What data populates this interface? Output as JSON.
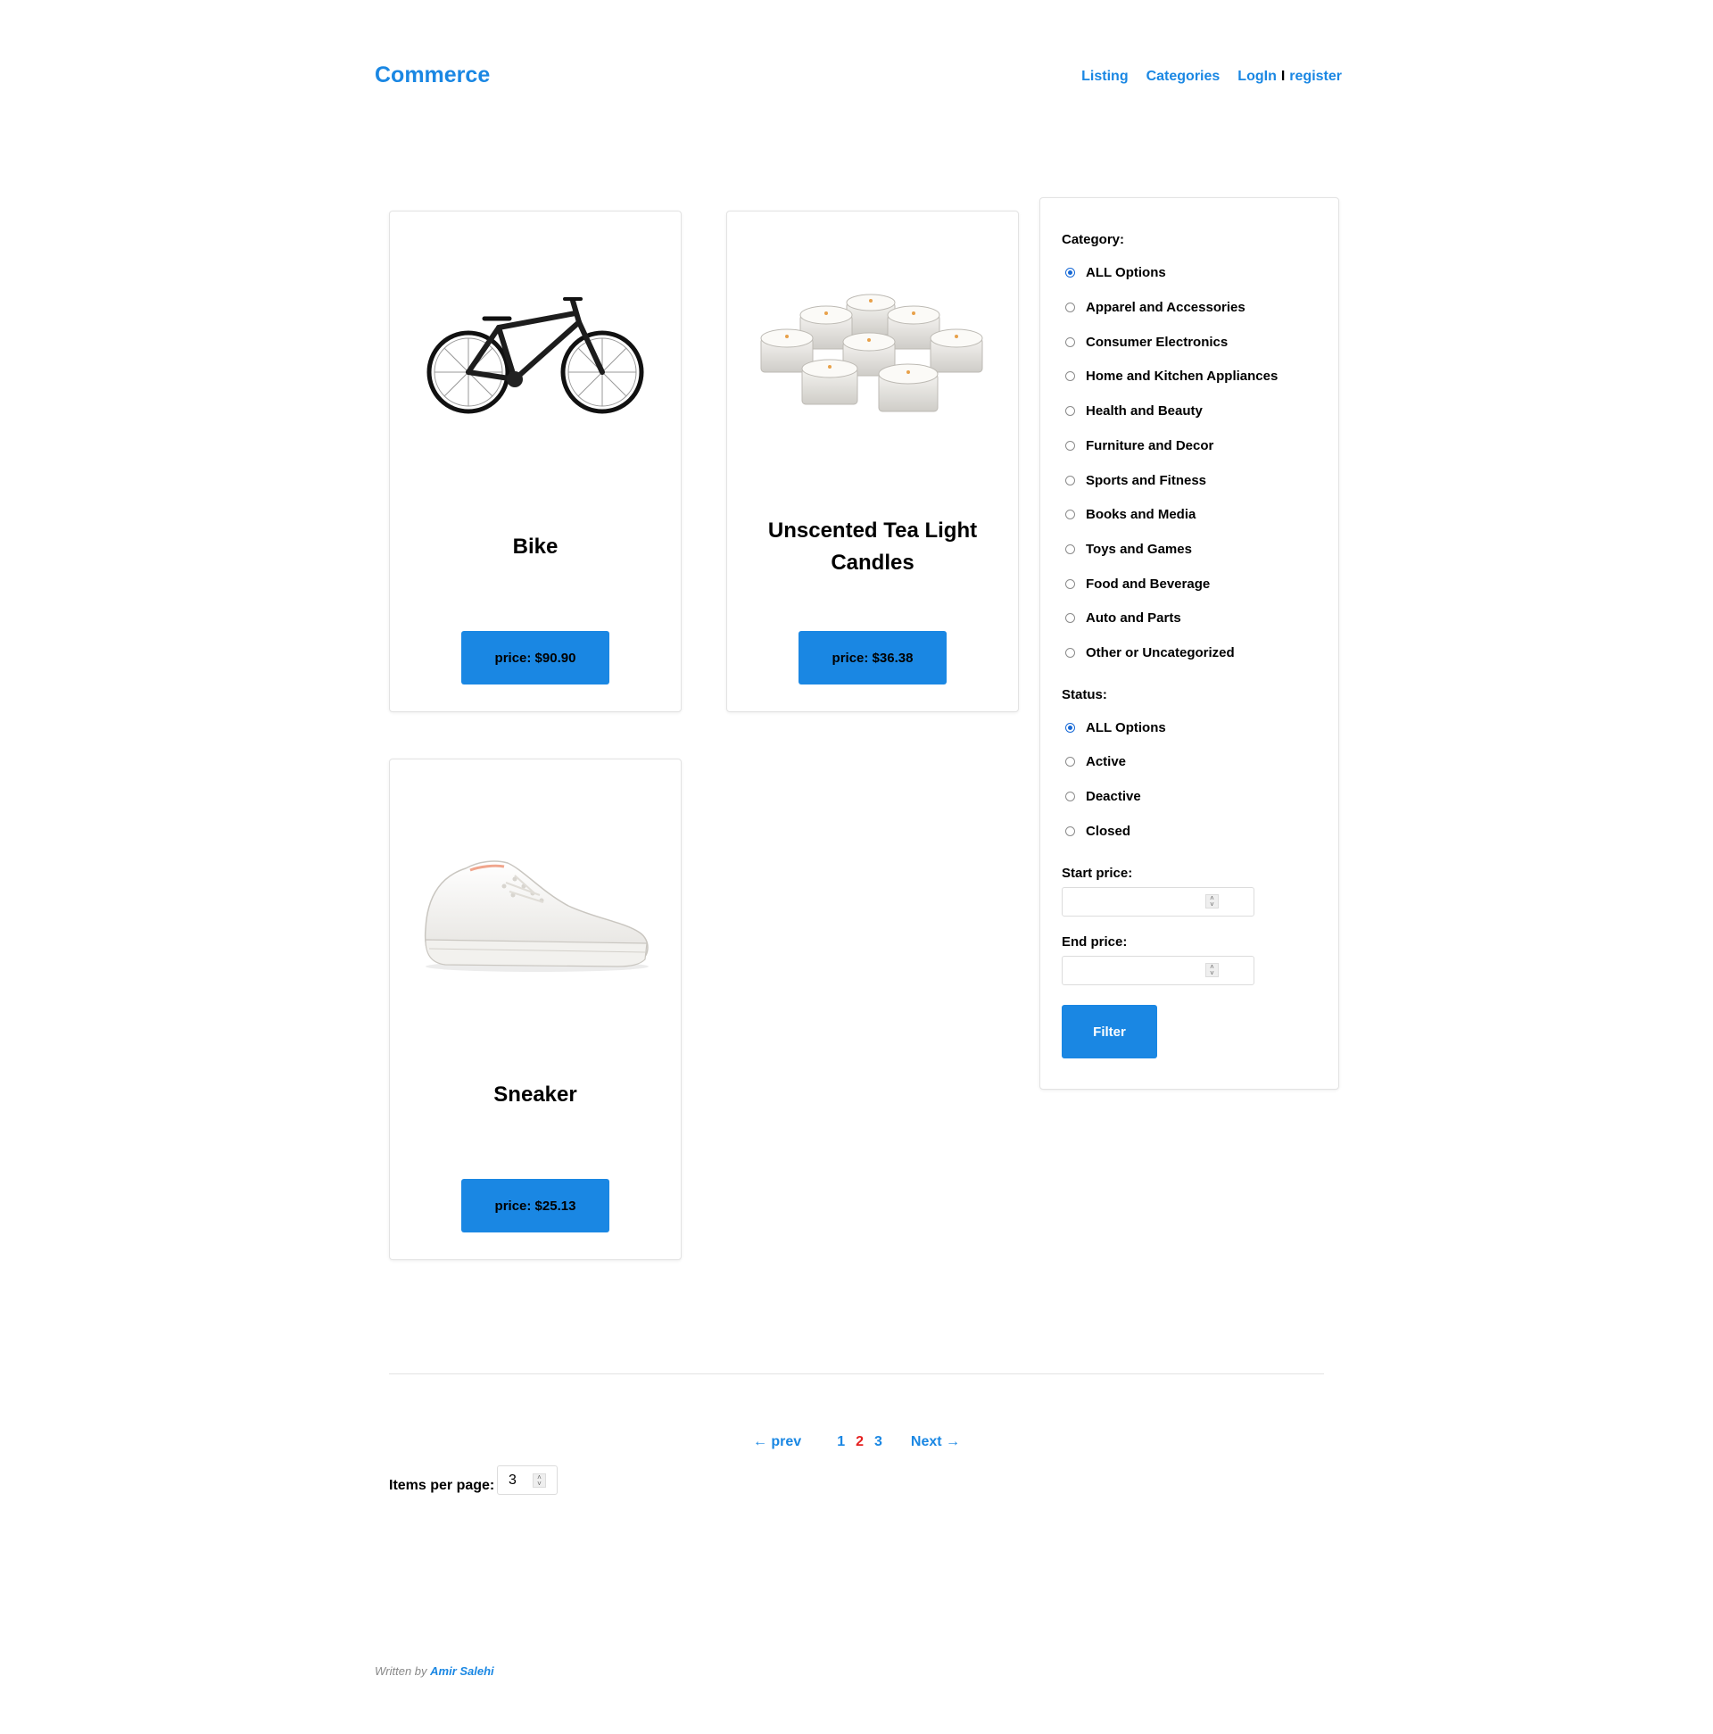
{
  "header": {
    "brand": "Commerce",
    "nav": {
      "listing": "Listing",
      "categories": "Categories",
      "login": "LogIn",
      "separator": "I",
      "register": "register"
    }
  },
  "listings": [
    {
      "title": "Bike",
      "price": "price: $90.90",
      "image_icon": "bike-image"
    },
    {
      "title": "Unscented Tea Light Candles",
      "price": "price: $36.38",
      "image_icon": "candles-image"
    },
    {
      "title": "Sneaker",
      "price": "price: $25.13",
      "image_icon": "sneaker-image"
    }
  ],
  "filter": {
    "category_label": "Category:",
    "categories": [
      "ALL Options",
      "Apparel and Accessories",
      "Consumer Electronics",
      "Home and Kitchen Appliances",
      "Health and Beauty",
      "Furniture and Decor",
      "Sports and Fitness",
      "Books and Media",
      "Toys and Games",
      "Food and Beverage",
      "Auto and Parts",
      "Other or Uncategorized"
    ],
    "category_selected": "ALL Options",
    "status_label": "Status:",
    "statuses": [
      "ALL Options",
      "Active",
      "Deactive",
      "Closed"
    ],
    "status_selected": "ALL Options",
    "start_price_label": "Start price:",
    "start_price_value": "",
    "end_price_label": "End price:",
    "end_price_value": "",
    "button": "Filter"
  },
  "pagination": {
    "prev": "← prev",
    "pages": [
      "1",
      "2",
      "3"
    ],
    "current": "2",
    "next": "Next →"
  },
  "items_per_page": {
    "label": "Items per page:",
    "value": "3"
  },
  "footer": {
    "written_by": "Written by",
    "author": "Amir Salehi"
  },
  "colors": {
    "accent": "#1a87e3",
    "current_page": "#e51f1f"
  }
}
